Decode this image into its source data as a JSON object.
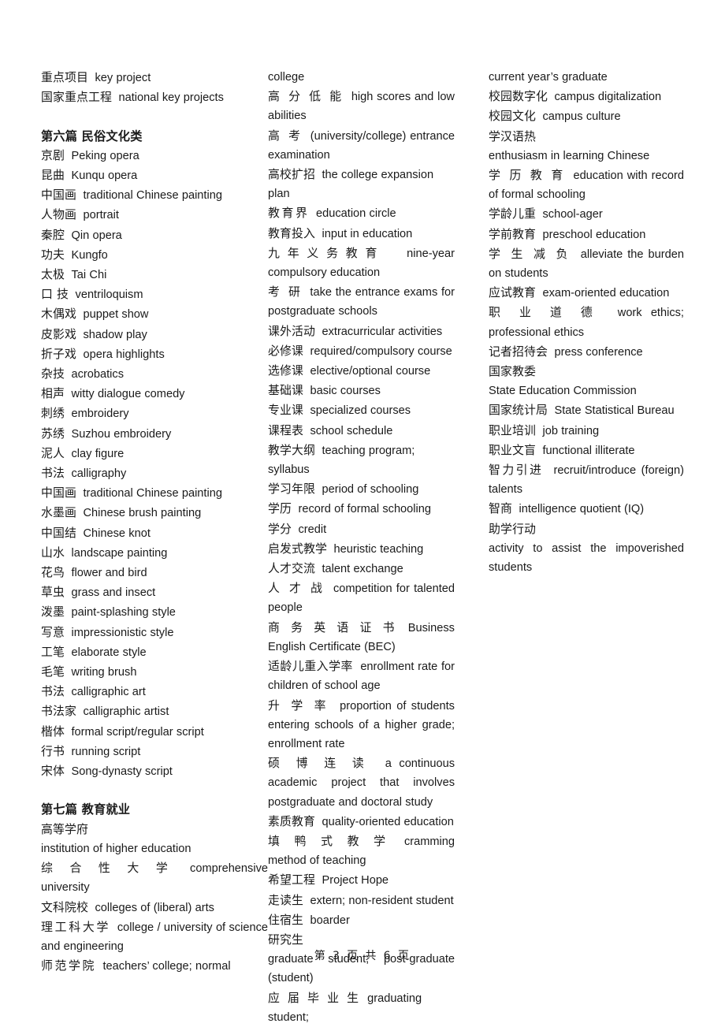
{
  "document": {
    "page_footer": "第 3 页 共 6 页",
    "page_number": "3",
    "total_pages": "6"
  },
  "columns": [
    {
      "id": "column-1",
      "blocks": [
        {
          "type": "entry",
          "zh": "重点项目",
          "en": "key project"
        },
        {
          "type": "entry",
          "zh": "国家重点工程",
          "en": "national key projects"
        },
        {
          "type": "spacer"
        },
        {
          "type": "heading",
          "text": "第六篇   民俗文化类"
        },
        {
          "type": "entry",
          "zh": "京剧",
          "en": "Peking opera"
        },
        {
          "type": "entry",
          "zh": "昆曲",
          "en": "Kunqu opera"
        },
        {
          "type": "entry",
          "zh": "中国画",
          "en": "traditional Chinese painting"
        },
        {
          "type": "entry",
          "zh": "人物画",
          "en": "portrait"
        },
        {
          "type": "entry",
          "zh": "秦腔",
          "en": "Qin opera"
        },
        {
          "type": "entry",
          "zh": "功夫",
          "en": "Kungfo"
        },
        {
          "type": "entry",
          "zh": "太极",
          "en": "Tai Chi"
        },
        {
          "type": "entry",
          "zh": "口 技",
          "en": "ventriloquism"
        },
        {
          "type": "entry",
          "zh": "木偶戏",
          "en": "puppet show"
        },
        {
          "type": "entry",
          "zh": "皮影戏",
          "en": "shadow play"
        },
        {
          "type": "entry",
          "zh": "折子戏",
          "en": "opera highlights"
        },
        {
          "type": "entry",
          "zh": "杂技",
          "en": "acrobatics"
        },
        {
          "type": "entry",
          "zh": "相声",
          "en": "witty dialogue comedy"
        },
        {
          "type": "entry",
          "zh": "刺绣",
          "en": "embroidery"
        },
        {
          "type": "entry",
          "zh": "苏绣",
          "en": "Suzhou embroidery"
        },
        {
          "type": "entry",
          "zh": "泥人",
          "en": "clay figure"
        },
        {
          "type": "entry",
          "zh": "书法",
          "en": "calligraphy"
        },
        {
          "type": "entry",
          "zh": "中国画",
          "en": "traditional Chinese painting"
        },
        {
          "type": "entry",
          "zh": "水墨画",
          "en": "Chinese brush painting"
        },
        {
          "type": "entry",
          "zh": "中国结",
          "en": "Chinese knot"
        },
        {
          "type": "entry",
          "zh": "山水",
          "en": "landscape painting"
        },
        {
          "type": "entry",
          "zh": "花鸟",
          "en": "flower and bird"
        },
        {
          "type": "entry",
          "zh": "草虫",
          "en": "grass and insect"
        },
        {
          "type": "entry",
          "zh": "泼墨",
          "en": "paint-splashing style"
        },
        {
          "type": "entry",
          "zh": "写意",
          "en": "impressionistic style"
        },
        {
          "type": "entry",
          "zh": "工笔",
          "en": "elaborate style"
        },
        {
          "type": "entry",
          "zh": "毛笔",
          "en": "writing brush"
        },
        {
          "type": "entry",
          "zh": "书法",
          "en": "calligraphic art"
        },
        {
          "type": "entry",
          "zh": "书法家",
          "en": "calligraphic artist"
        },
        {
          "type": "entry",
          "zh": "楷体",
          "en": "formal script/regular script"
        },
        {
          "type": "entry",
          "zh": "行书",
          "en": "running script"
        },
        {
          "type": "entry",
          "zh": "宋体",
          "en": "Song-dynasty script"
        },
        {
          "type": "spacer"
        },
        {
          "type": "heading",
          "text": "第七篇   教育就业"
        },
        {
          "type": "entry",
          "zh": "高等学府",
          "en": "institution of higher education",
          "wrap": true
        },
        {
          "type": "entry",
          "zh": "综 合 性 大 学",
          "en": "comprehensive university",
          "justify": true,
          "spaced": true
        },
        {
          "type": "entry",
          "zh": "文科院校",
          "en": "colleges of (liberal) arts"
        },
        {
          "type": "entry",
          "zh": "理工科大学",
          "en": "college / university of science and engineering",
          "justify": true,
          "spaced": true
        },
        {
          "type": "entry",
          "zh": "师范学院",
          "en": "teachers’ college; normal",
          "spaced": true
        }
      ]
    },
    {
      "id": "column-2",
      "blocks": [
        {
          "type": "cont",
          "en": "college"
        },
        {
          "type": "entry",
          "zh": "高 分 低 能",
          "en": "high scores and low abilities",
          "justify": true,
          "spaced": true
        },
        {
          "type": "entry",
          "zh": "高 考",
          "en": "(university/college) entrance examination",
          "justify": true,
          "spaced": true
        },
        {
          "type": "entry",
          "zh": "高校扩招",
          "en": "the college expansion plan"
        },
        {
          "type": "entry",
          "zh": "教育界",
          "en": "education circle",
          "spaced": true
        },
        {
          "type": "entry",
          "zh": "教育投入",
          "en": "input in education"
        },
        {
          "type": "entry",
          "zh": "九年义务教育",
          "en": "nine-year compulsory education",
          "justify": true
        },
        {
          "type": "entry",
          "zh": "考 研",
          "en": "take the entrance exams for postgraduate schools",
          "justify": true,
          "spaced": true
        },
        {
          "type": "entry",
          "zh": "课外活动",
          "en": "extracurricular activities"
        },
        {
          "type": "entry",
          "zh": "必修课",
          "en": "required/compulsory course"
        },
        {
          "type": "entry",
          "zh": "选修课",
          "en": "elective/optional course"
        },
        {
          "type": "entry",
          "zh": "基础课",
          "en": "basic courses"
        },
        {
          "type": "entry",
          "zh": "专业课",
          "en": "specialized courses"
        },
        {
          "type": "entry",
          "zh": "课程表",
          "en": "school schedule"
        },
        {
          "type": "entry",
          "zh": "教学大纲",
          "en": "teaching program; syllabus"
        },
        {
          "type": "entry",
          "zh": "学习年限",
          "en": "period of schooling"
        },
        {
          "type": "entry",
          "zh": "学历",
          "en": "record of formal schooling"
        },
        {
          "type": "entry",
          "zh": "学分",
          "en": "credit"
        },
        {
          "type": "entry",
          "zh": "启发式教学",
          "en": "heuristic teaching"
        },
        {
          "type": "entry",
          "zh": "人才交流",
          "en": "talent exchange"
        },
        {
          "type": "entry",
          "zh": "人 才 战",
          "en": "competition for talented people",
          "justify": true,
          "spaced": true
        },
        {
          "type": "entry",
          "zh": "商 务 英 语 证 书",
          "en": "Business English Certificate (BEC)",
          "justify": true,
          "spaced": true
        },
        {
          "type": "entry",
          "zh": "适龄儿重入学率",
          "en": "enrollment rate for children of school age",
          "justify": true
        },
        {
          "type": "entry",
          "zh": "升 学 率",
          "en": "proportion of students entering schools of a higher grade; enrollment rate",
          "justify": true,
          "spaced": true
        },
        {
          "type": "entry",
          "zh": "硕 博 连 读",
          "en": "a continuous academic project that involves postgraduate and doctoral study",
          "justify": true,
          "spaced": true
        },
        {
          "type": "entry",
          "zh": "素质教育",
          "en": "quality-oriented education"
        },
        {
          "type": "entry",
          "zh": "填 鸭 式 教 学",
          "en": "cramming method of teaching",
          "justify": true,
          "spaced": true
        },
        {
          "type": "entry",
          "zh": "希望工程",
          "en": "Project Hope"
        },
        {
          "type": "entry",
          "zh": "走读生",
          "en": "extern; non-resident student"
        },
        {
          "type": "entry",
          "zh": "住宿生",
          "en": "boarder"
        },
        {
          "type": "entry",
          "zh": "研究生",
          "en": "graduate student; post-graduate (student)",
          "wrap": true,
          "justify": true
        },
        {
          "type": "entry",
          "zh": "应 届 毕 业 生",
          "en": "graduating student;",
          "spaced": true
        }
      ]
    },
    {
      "id": "column-3",
      "blocks": [
        {
          "type": "cont",
          "en": "current year’s graduate"
        },
        {
          "type": "entry",
          "zh": "校园数字化",
          "en": "campus digitalization"
        },
        {
          "type": "entry",
          "zh": "校园文化",
          "en": "campus culture"
        },
        {
          "type": "entry",
          "zh": "学汉语热",
          "en": "enthusiasm in learning Chinese",
          "wrap": true
        },
        {
          "type": "entry",
          "zh": "学 历 教 育",
          "en": "education with record of formal schooling",
          "justify": true,
          "spaced": true
        },
        {
          "type": "entry",
          "zh": "学龄儿重",
          "en": "school-ager"
        },
        {
          "type": "entry",
          "zh": "学前教育",
          "en": "preschool education"
        },
        {
          "type": "entry",
          "zh": "学 生 减 负",
          "en": "alleviate the burden on students",
          "justify": true,
          "spaced": true
        },
        {
          "type": "entry",
          "zh": "应试教育",
          "en": "exam-oriented education"
        },
        {
          "type": "entry",
          "zh": "职 业 道 德",
          "en": "work ethics; professional ethics",
          "justify": true,
          "spaced": true
        },
        {
          "type": "entry",
          "zh": "记者招待会",
          "en": "press conference"
        },
        {
          "type": "entry",
          "zh": "国家教委",
          "en": "State Education Commission",
          "wrap": true
        },
        {
          "type": "entry",
          "zh": "国家统计局",
          "en": "State Statistical Bureau"
        },
        {
          "type": "entry",
          "zh": "职业培训",
          "en": "job training"
        },
        {
          "type": "entry",
          "zh": "职业文盲",
          "en": "functional illiterate"
        },
        {
          "type": "entry",
          "zh": "智力引进",
          "en": "recruit/introduce (foreign) talents",
          "justify": true
        },
        {
          "type": "entry",
          "zh": "智商",
          "en": "intelligence quotient (IQ)"
        },
        {
          "type": "entry",
          "zh": "助学行动",
          "en": "activity to assist the impoverished students",
          "wrap": true,
          "justify": true
        }
      ]
    }
  ]
}
